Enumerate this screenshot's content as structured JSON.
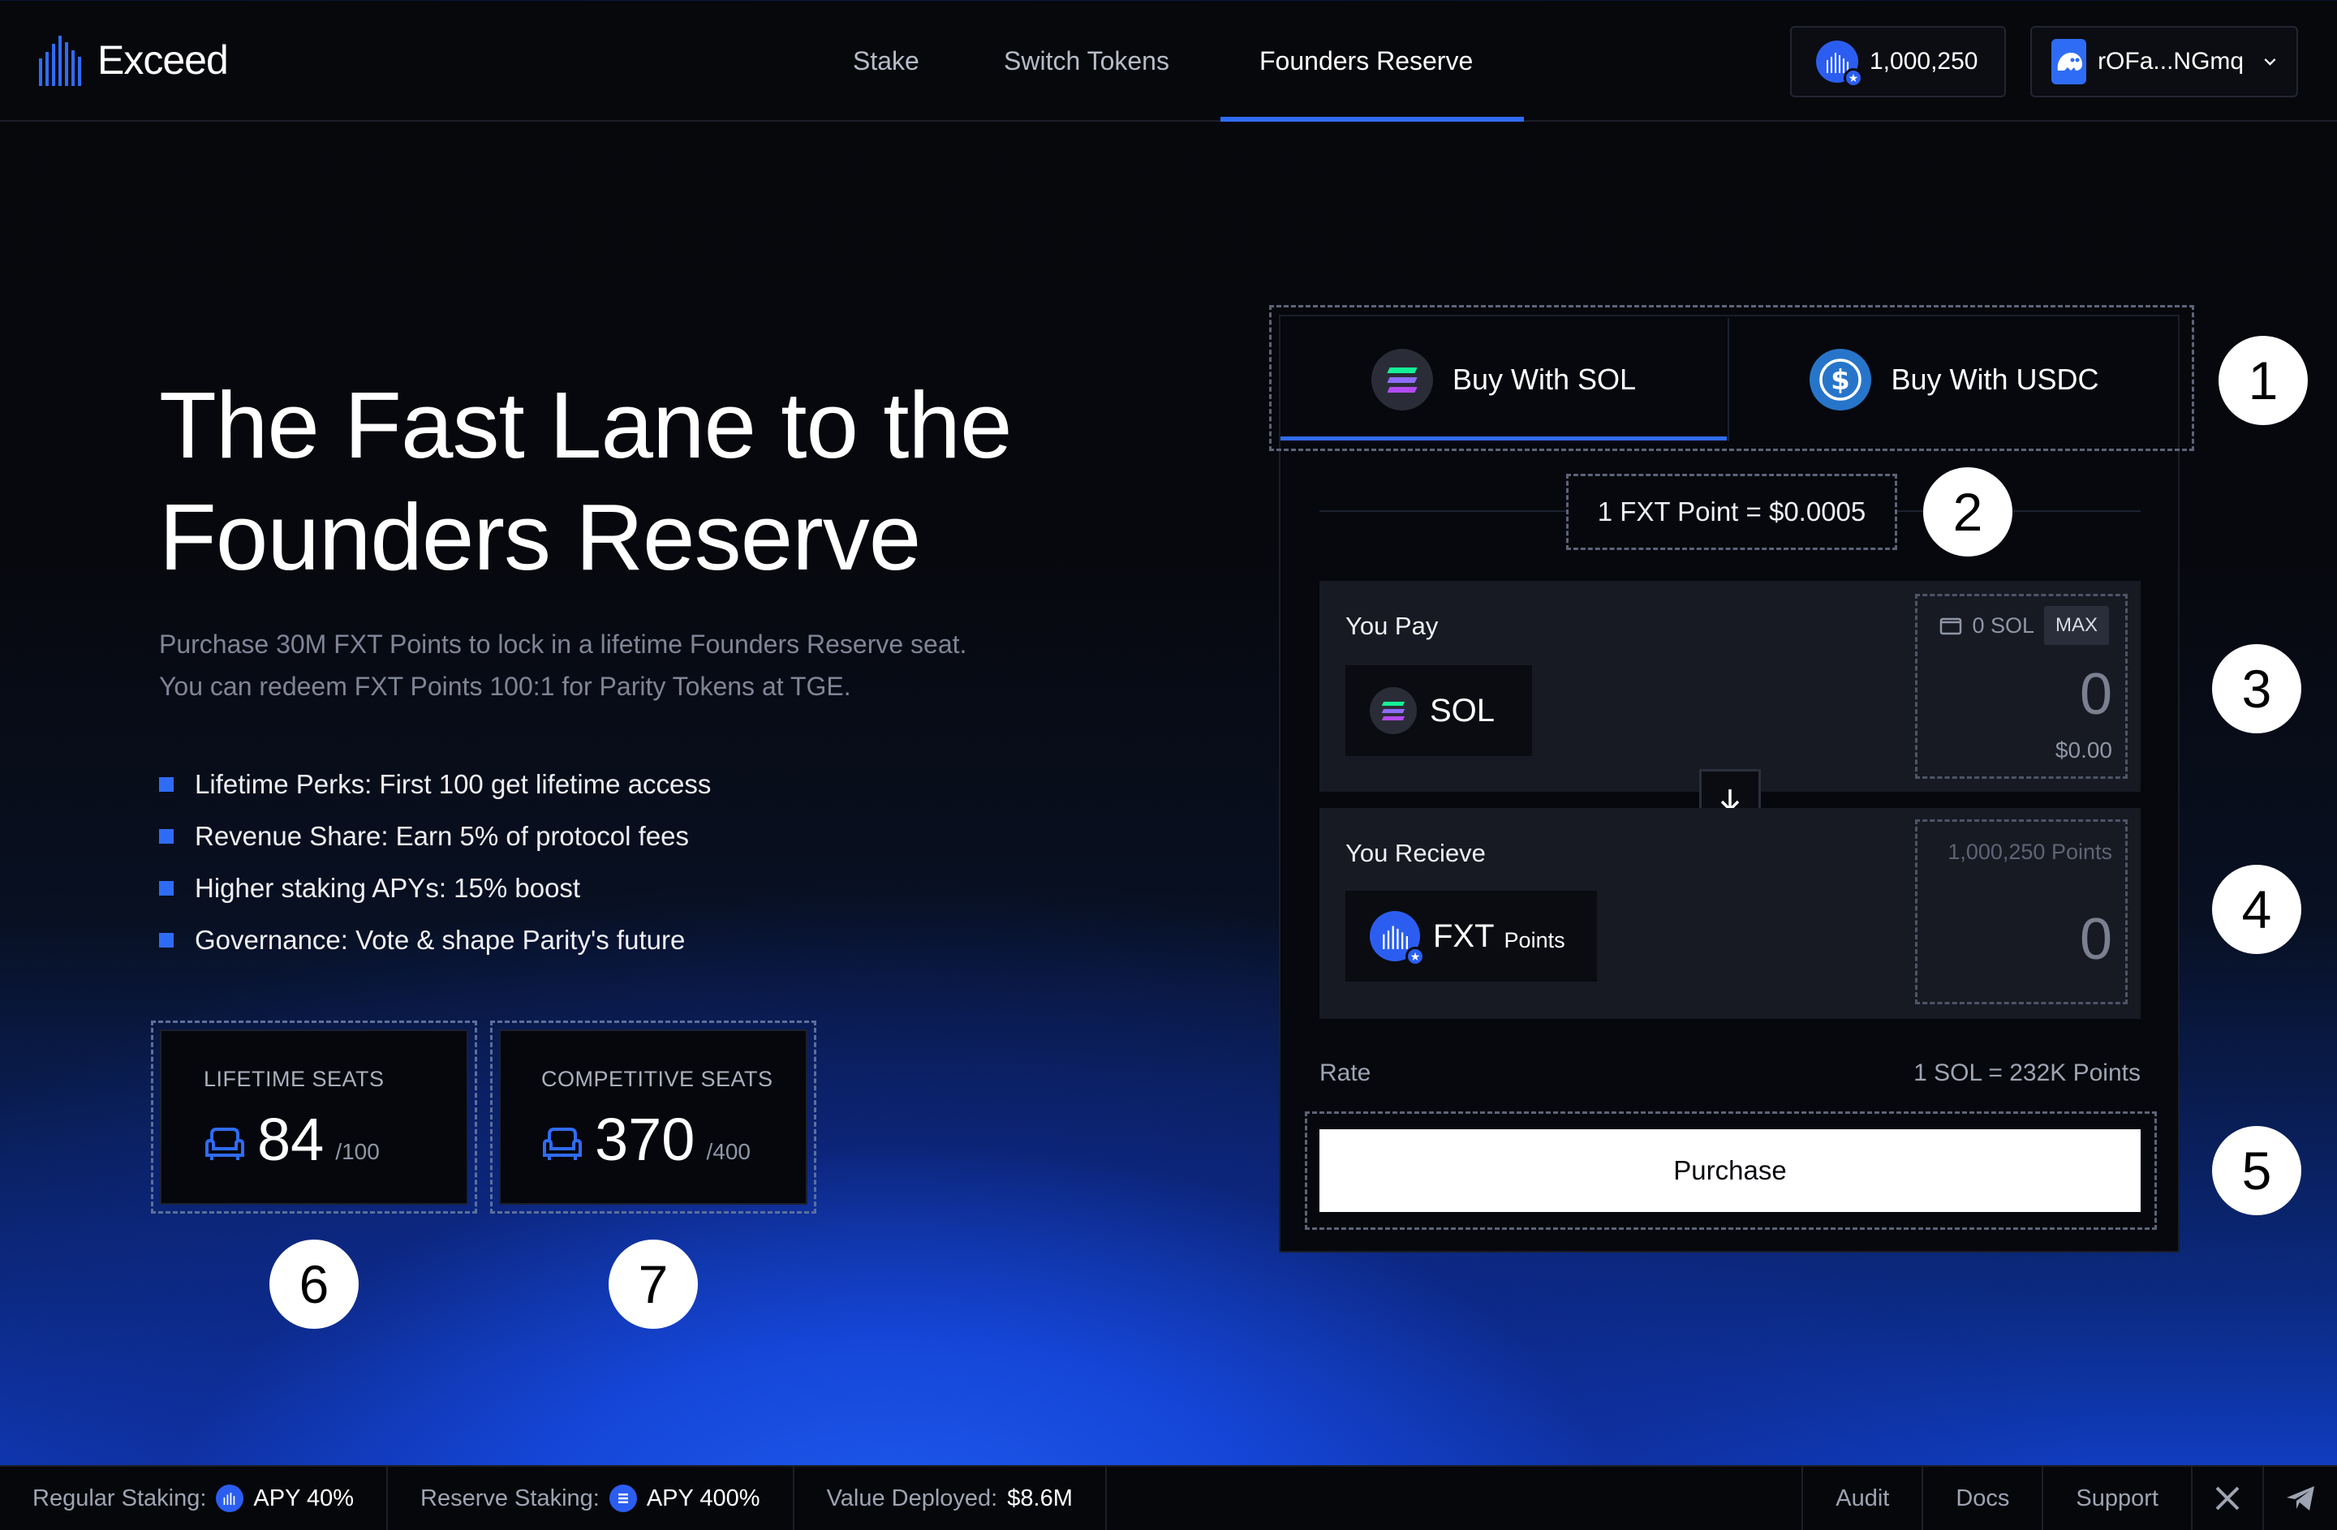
{
  "app": {
    "name": "Exceed"
  },
  "nav": {
    "items": [
      {
        "label": "Stake"
      },
      {
        "label": "Switch Tokens"
      },
      {
        "label": "Founders Reserve"
      }
    ],
    "active": "Founders Reserve"
  },
  "header": {
    "points_balance": "1,000,250",
    "wallet_address": "rOFa...NGmq"
  },
  "hero": {
    "title_line1": "The Fast Lane to the",
    "title_line2": "Founders Reserve",
    "subtitle_line1": "Purchase 30M FXT Points to lock in a lifetime Founders Reserve seat.",
    "subtitle_line2": "You can redeem FXT Points 100:1 for Parity Tokens at TGE.",
    "perks": [
      "Lifetime Perks: First 100 get lifetime access",
      "Revenue Share: Earn 5% of protocol fees",
      "Higher staking APYs: 15% boost",
      "Governance: Vote & shape Parity's future"
    ]
  },
  "seats": {
    "lifetime": {
      "label": "LIFETIME SEATS",
      "value": "84",
      "max": "/100"
    },
    "competitive": {
      "label": "COMPETITIVE SEATS",
      "value": "370",
      "max": "/400"
    }
  },
  "purchase": {
    "tabs": [
      {
        "label": "Buy With SOL",
        "icon": "solana-icon"
      },
      {
        "label": "Buy With USDC",
        "icon": "usdc-icon"
      }
    ],
    "active_tab": "Buy With SOL",
    "rate_pill": "1 FXT Point = $0.0005",
    "pay": {
      "label": "You Pay",
      "token": "SOL",
      "balance": "0 SOL",
      "max_label": "MAX",
      "amount": "0",
      "usd_value": "$0.00"
    },
    "receive": {
      "label": "You Recieve",
      "token": "FXT",
      "token_suffix": "Points",
      "balance": "1,000,250 Points",
      "amount": "0"
    },
    "rate_label": "Rate",
    "rate_value": "1 SOL = 232K Points",
    "purchase_button": "Purchase"
  },
  "annotations": [
    "1",
    "2",
    "3",
    "4",
    "5",
    "6",
    "7"
  ],
  "footer": {
    "regular_label": "Regular Staking:",
    "regular_value": "APY 40%",
    "reserve_label": "Reserve Staking:",
    "reserve_value": "APY 400%",
    "deployed_label": "Value Deployed:",
    "deployed_value": "$8.6M",
    "links": [
      "Audit",
      "Docs",
      "Support"
    ]
  },
  "colors": {
    "accent": "#2f6cf5",
    "background": "#07080c",
    "panel": "#171a22",
    "usdc": "#2775ca"
  }
}
